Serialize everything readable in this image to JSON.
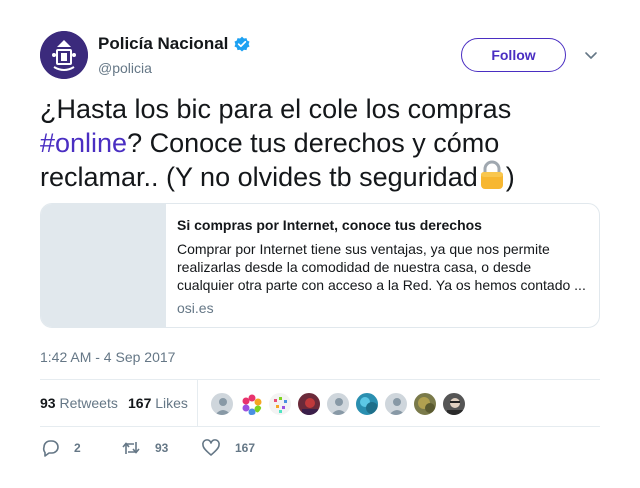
{
  "user": {
    "display_name": "Policía Nacional",
    "handle": "@policia",
    "verified": true
  },
  "follow_label": "Follow",
  "tweet": {
    "text_part1": "¿Hasta los bic para el cole los compras ",
    "hashtag": "#online",
    "text_part2": "? Conoce tus derechos y cómo reclamar.. (Y no olvides tb seguridad",
    "text_part3": ")",
    "emoji": "lock-icon"
  },
  "card": {
    "title": "Si compras por Internet, conoce tus derechos",
    "description": "Comprar por Internet tiene sus ventajas, ya que nos permite realizarlas desde la comodidad de nuestra casa, o desde cualquier otra parte con acceso a la Red. Ya os hemos contado ...",
    "domain": "osi.es"
  },
  "timestamp": "1:42 AM - 4 Sep 2017",
  "stats": {
    "retweets_count": "93",
    "retweets_label": "Retweets",
    "likes_count": "167",
    "likes_label": "Likes"
  },
  "actions": {
    "reply_count": "2",
    "retweet_count": "93",
    "like_count": "167"
  },
  "colors": {
    "accent": "#4a2ec2",
    "verified": "#1da1f2",
    "muted": "#657786"
  }
}
